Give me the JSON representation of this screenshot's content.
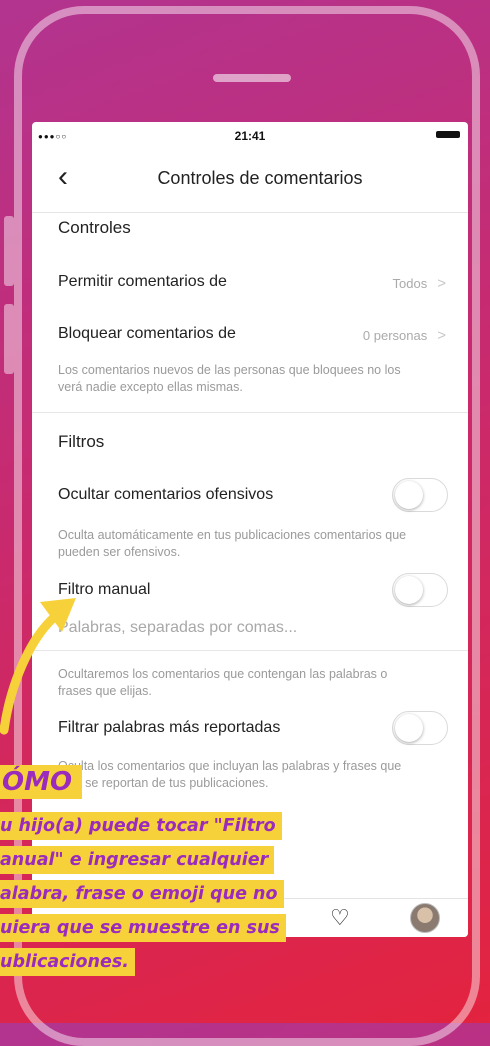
{
  "status_bar": {
    "signal": "●●●○○",
    "time": "21:41"
  },
  "nav": {
    "back_icon": "chevron-left",
    "title": "Controles de comentarios"
  },
  "controles": {
    "section_title": "Controles",
    "permitir": {
      "label": "Permitir comentarios de",
      "value": "Todos"
    },
    "bloquear": {
      "label": "Bloquear comentarios de",
      "value": "0 personas"
    },
    "description": "Los comentarios nuevos de las personas que bloquees no los verá nadie excepto ellas mismas."
  },
  "filtros": {
    "section_title": "Filtros",
    "ofensivos": {
      "label": "Ocultar comentarios ofensivos",
      "enabled": false,
      "description": "Oculta automáticamente en tus publicaciones comentarios que pueden ser ofensivos."
    },
    "manual": {
      "label": "Filtro manual",
      "enabled": false,
      "placeholder": "Palabras, separadas por comas...",
      "description": "Ocultaremos los comentarios que contengan las palabras o frases que elijas."
    },
    "reportadas": {
      "label": "Filtrar palabras más reportadas",
      "enabled": false,
      "description": "Oculta los comentarios que incluyan las palabras y frases que más se reportan de tus publicaciones."
    }
  },
  "tab_bar": {
    "icons": [
      "heart-icon",
      "profile-avatar"
    ]
  },
  "callout": {
    "title": "ÓMO",
    "lines": [
      "u hijo(a) puede tocar \"Filtro",
      "anual\" e ingresar cualquier",
      "alabra, frase o emoji que no",
      "uiera que se muestre en sus",
      "ublicaciones."
    ]
  },
  "colors": {
    "accent_yellow": "#f7d13a",
    "callout_text": "#9a2bbd",
    "bg_top": "#b2348f",
    "bg_bottom": "#e3233f"
  }
}
